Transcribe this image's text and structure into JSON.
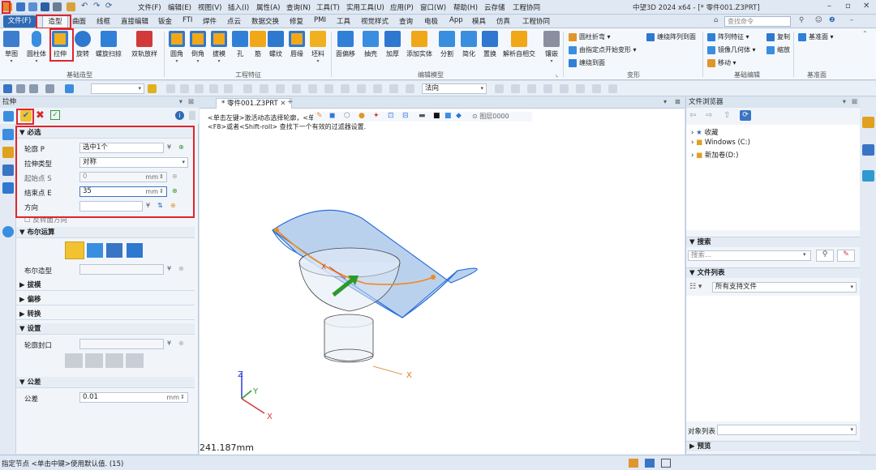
{
  "menu": [
    "文件(F)",
    "编辑(E)",
    "视图(V)",
    "插入(I)",
    "属性(A)",
    "查询(N)",
    "工具(T)",
    "实用工具(U)",
    "应用(P)",
    "窗口(W)",
    "帮助(H)",
    "云存储",
    "工程协同"
  ],
  "app_title": "中望3D 2024 x64 - [* 零件001.Z3PRT]",
  "search_placeholder": "查找命令",
  "tabs": [
    "文件(F)",
    "造型",
    "曲面",
    "线框",
    "直接编辑",
    "钣金",
    "FTI",
    "焊件",
    "点云",
    "数据交换",
    "修复",
    "PMI",
    "工具",
    "视觉样式",
    "查询",
    "电极",
    "App",
    "模具",
    "仿真",
    "工程协同"
  ],
  "ribbon": {
    "basic": [
      "草图",
      "圆柱体",
      "拉伸",
      "旋转",
      "螺旋扫掠",
      "双轨放样"
    ],
    "basic_label": "基础造型",
    "feature": [
      "圆角",
      "倒角",
      "拔模",
      "孔",
      "筋",
      "螺纹",
      "唇缘",
      "坯料"
    ],
    "feature_label": "工程特征",
    "edit": [
      "面偏移",
      "抽壳",
      "加厚",
      "添加实体",
      "分割",
      "简化",
      "置换",
      "解析自相交",
      "镶嵌"
    ],
    "edit_label": "编辑模型",
    "deform_tools": [
      "圆柱折弯",
      "由指定点开始变形",
      "缠绕到面"
    ],
    "deform_label": "变形",
    "extra_tool": "缠绕阵列到面",
    "basic_edit": [
      "阵列特征",
      "镜像几何体",
      "移动",
      "复制",
      "缩放"
    ],
    "basic_edit_label": "基础编辑",
    "datum": "基准面",
    "datum_label": "基准面"
  },
  "toolbar2": {
    "filter": "法向"
  },
  "left_panel": {
    "title": "拉伸",
    "required_label": "必选",
    "fields": {
      "profile_label": "轮廓 P",
      "profile_value": "选中1个",
      "type_label": "拉伸类型",
      "type_value": "对称",
      "start_label": "起始点 S",
      "start_value": "0",
      "start_unit": "mm",
      "end_label": "结束点 E",
      "end_value": "35",
      "end_unit": "mm",
      "dir_label": "方向",
      "flip_label": "反转面方向"
    },
    "boolean_label": "布尔运算",
    "boolean_shape_label": "布尔造型",
    "sections": [
      "拔模",
      "偏移",
      "转换"
    ],
    "settings_label": "设置",
    "profile_cap_label": "轮廓封口",
    "tolerance_label": "公差",
    "tolerance_item": "公差",
    "tolerance_value": "0.01",
    "tolerance_unit": "mm"
  },
  "viewport": {
    "tab": "* 零件001.Z3PRT",
    "hint1": "<单击左键>激活动态选择轮廓，<单击中键>结束选择",
    "hint2": "<F8>或者<Shift-roll> 查找下一个有效的过滤器设置.",
    "layer": "图层0000",
    "measure": "241.187mm",
    "axes": {
      "x": "X",
      "y": "Y",
      "z": "Z"
    }
  },
  "right_panel": {
    "title": "文件浏览器",
    "tree": [
      "收藏",
      "Windows (C:)",
      "新加卷(D:)"
    ],
    "search_label": "搜索",
    "search_placeholder": "搜索...",
    "file_list_label": "文件列表",
    "file_filter": "所有支持文件",
    "object_list_label": "对象列表",
    "preview_label": "预览"
  },
  "status": "指定节点 <单击中键>使用默认值. (15)",
  "colors": {
    "accent": "#2f6ab4",
    "highlight": "#e0242d",
    "surface": "#9fc1e8",
    "edge": "#2a70d8"
  }
}
